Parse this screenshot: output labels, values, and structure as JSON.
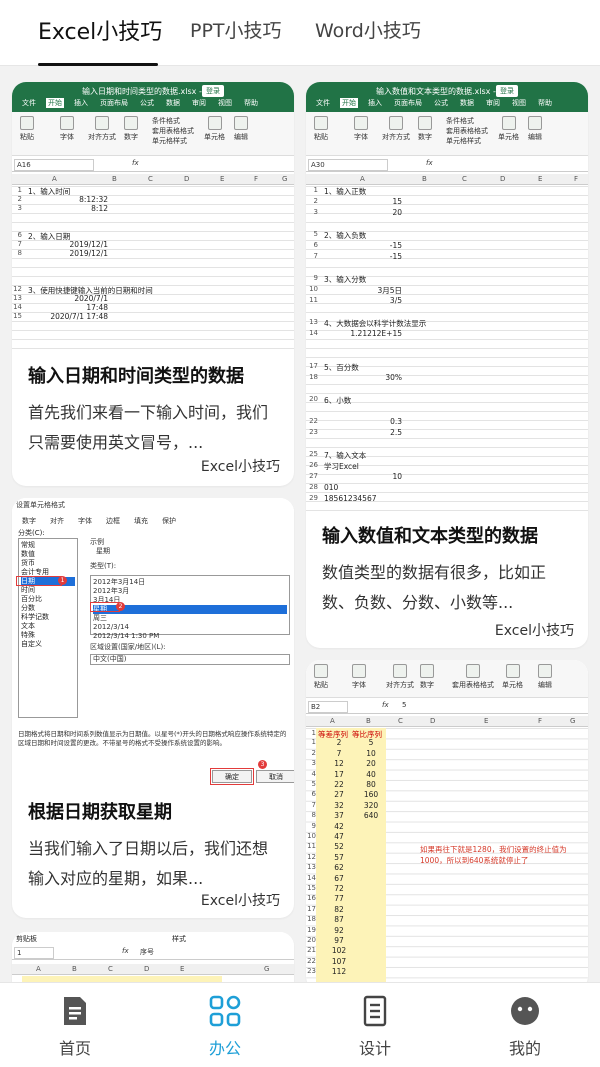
{
  "tabs": [
    {
      "label": "Excel小技巧",
      "active": true
    },
    {
      "label": "PPT小技巧",
      "active": false
    },
    {
      "label": "Word小技巧",
      "active": false
    }
  ],
  "cards": [
    {
      "title": "输入日期和时间类型的数据",
      "desc": "首先我们来看一下输入时间，我们只需要使用英文冒号，...",
      "source": "Excel小技巧",
      "file_title": "输入日期和时间类型的数据.xlsx - E...",
      "login": "登录",
      "namebox": "A16",
      "formula": "",
      "rows": [
        {
          "n": "1",
          "a": "1、输入时间",
          "b": ""
        },
        {
          "n": "2",
          "a": "",
          "b": "8:12:32"
        },
        {
          "n": "3",
          "a": "",
          "b": "8:12"
        },
        {
          "n": "6",
          "a": "2、输入日期",
          "b": ""
        },
        {
          "n": "7",
          "a": "",
          "b": "2019/12/1"
        },
        {
          "n": "8",
          "a": "",
          "b": "2019/12/1"
        },
        {
          "n": "12",
          "a": "3、使用快捷键输入当前的日期和时间",
          "b": ""
        },
        {
          "n": "13",
          "a": "",
          "b": "2020/7/1"
        },
        {
          "n": "14",
          "a": "",
          "b": "17:48"
        },
        {
          "n": "15",
          "a": "",
          "b": "2020/7/1 17:48"
        }
      ]
    },
    {
      "title": "输入数值和文本类型的数据",
      "desc": "数值类型的数据有很多，比如正数、负数、分数、小数等...",
      "source": "Excel小技巧",
      "file_title": "输入数值和文本类型的数据.xlsx - E...",
      "login": "登录",
      "namebox": "A30",
      "formula": "",
      "rows": [
        {
          "n": "1",
          "a": "1、输入正数",
          "b": ""
        },
        {
          "n": "2",
          "a": "",
          "b": "15"
        },
        {
          "n": "3",
          "a": "",
          "b": "20"
        },
        {
          "n": "5",
          "a": "2、输入负数",
          "b": ""
        },
        {
          "n": "6",
          "a": "",
          "b": "-15"
        },
        {
          "n": "7",
          "a": "",
          "b": "-15"
        },
        {
          "n": "9",
          "a": "3、输入分数",
          "b": ""
        },
        {
          "n": "10",
          "a": "",
          "b": "3月5日"
        },
        {
          "n": "11",
          "a": "",
          "b": "3/5"
        },
        {
          "n": "13",
          "a": "4、大数据会以科学计数法显示",
          "b": ""
        },
        {
          "n": "14",
          "a": "",
          "b": "1.21212E+15"
        },
        {
          "n": "17",
          "a": "5、百分数",
          "b": ""
        },
        {
          "n": "18",
          "a": "",
          "b": "30%"
        },
        {
          "n": "20",
          "a": "6、小数",
          "b": ""
        },
        {
          "n": "22",
          "a": "",
          "b": "0.3"
        },
        {
          "n": "23",
          "a": "",
          "b": "2.5"
        },
        {
          "n": "25",
          "a": "7、输入文本",
          "b": ""
        },
        {
          "n": "26",
          "a": "学习Excel",
          "b": ""
        },
        {
          "n": "27",
          "a": "",
          "b": "10"
        },
        {
          "n": "28",
          "a": "010",
          "b": ""
        },
        {
          "n": "29",
          "a": "18561234567",
          "b": ""
        }
      ]
    },
    {
      "title": "根据日期获取星期",
      "desc": "当我们输入了日期以后，我们还想输入对应的星期，如果...",
      "source": "Excel小技巧",
      "dialog": {
        "title": "设置单元格格式",
        "tabs": [
          "数字",
          "对齐",
          "字体",
          "边框",
          "填充",
          "保护"
        ],
        "category_label": "分类(C):",
        "categories": [
          "常规",
          "数值",
          "货币",
          "会计专用",
          "日期",
          "时间",
          "百分比",
          "分数",
          "科学记数",
          "文本",
          "特殊",
          "自定义"
        ],
        "sample_label": "示例",
        "sample_value": "星期",
        "type_label": "类型(T):",
        "types": [
          "2012年3月14日",
          "2012年3月",
          "3月14日",
          "星期",
          "周三",
          "2012/3/14",
          "2012/3/14 1:30 PM"
        ],
        "locale_label": "区域设置(国家/地区)(L):",
        "locale_value": "中文(中国)",
        "note": "日期格式将日期和时间系列数值显示为日期值。以星号(*)开头的日期格式响应操作系统特定的区域日期和时间设置的更改。不带星号的格式不受操作系统设置的影响。",
        "ok": "确定",
        "cancel": "取消",
        "markers": [
          "1",
          "2",
          "3"
        ]
      }
    },
    {
      "ribbon_groups": [
        "粘贴",
        "字体",
        "对齐方式",
        "数字",
        "套用表格格式",
        "单元格",
        "编辑"
      ],
      "namebox": "B2",
      "formula": "5",
      "headers": [
        "等差序列",
        "等比序列"
      ],
      "rows": [
        [
          "1",
          "2",
          "5"
        ],
        [
          "2",
          "7",
          "10"
        ],
        [
          "3",
          "12",
          "20"
        ],
        [
          "4",
          "17",
          "40"
        ],
        [
          "5",
          "22",
          "80"
        ],
        [
          "6",
          "27",
          "160"
        ],
        [
          "7",
          "32",
          "320"
        ],
        [
          "8",
          "37",
          "640"
        ],
        [
          "9",
          "42",
          ""
        ],
        [
          "10",
          "47",
          ""
        ],
        [
          "11",
          "52",
          ""
        ],
        [
          "12",
          "57",
          ""
        ],
        [
          "13",
          "62",
          ""
        ],
        [
          "14",
          "67",
          ""
        ],
        [
          "15",
          "72",
          ""
        ],
        [
          "16",
          "77",
          ""
        ],
        [
          "17",
          "82",
          ""
        ],
        [
          "18",
          "87",
          ""
        ],
        [
          "19",
          "92",
          ""
        ],
        [
          "20",
          "97",
          ""
        ],
        [
          "21",
          "102",
          ""
        ],
        [
          "22",
          "107",
          ""
        ],
        [
          "23",
          "112",
          ""
        ]
      ],
      "note": "如果再往下就是1280，我们设置的终止值为1000，所以到640系统就停止了"
    },
    {
      "namebox": "1",
      "formula": "序号",
      "group_left": "剪贴板",
      "group_right": "样式"
    }
  ],
  "nav": [
    {
      "label": "首页",
      "icon": "document-icon",
      "active": false
    },
    {
      "label": "办公",
      "icon": "grid-icon",
      "active": true
    },
    {
      "label": "设计",
      "icon": "notes-icon",
      "active": false
    },
    {
      "label": "我的",
      "icon": "face-icon",
      "active": false
    }
  ],
  "colors": {
    "accent": "#1e9fd7",
    "excel_green": "#217346"
  }
}
